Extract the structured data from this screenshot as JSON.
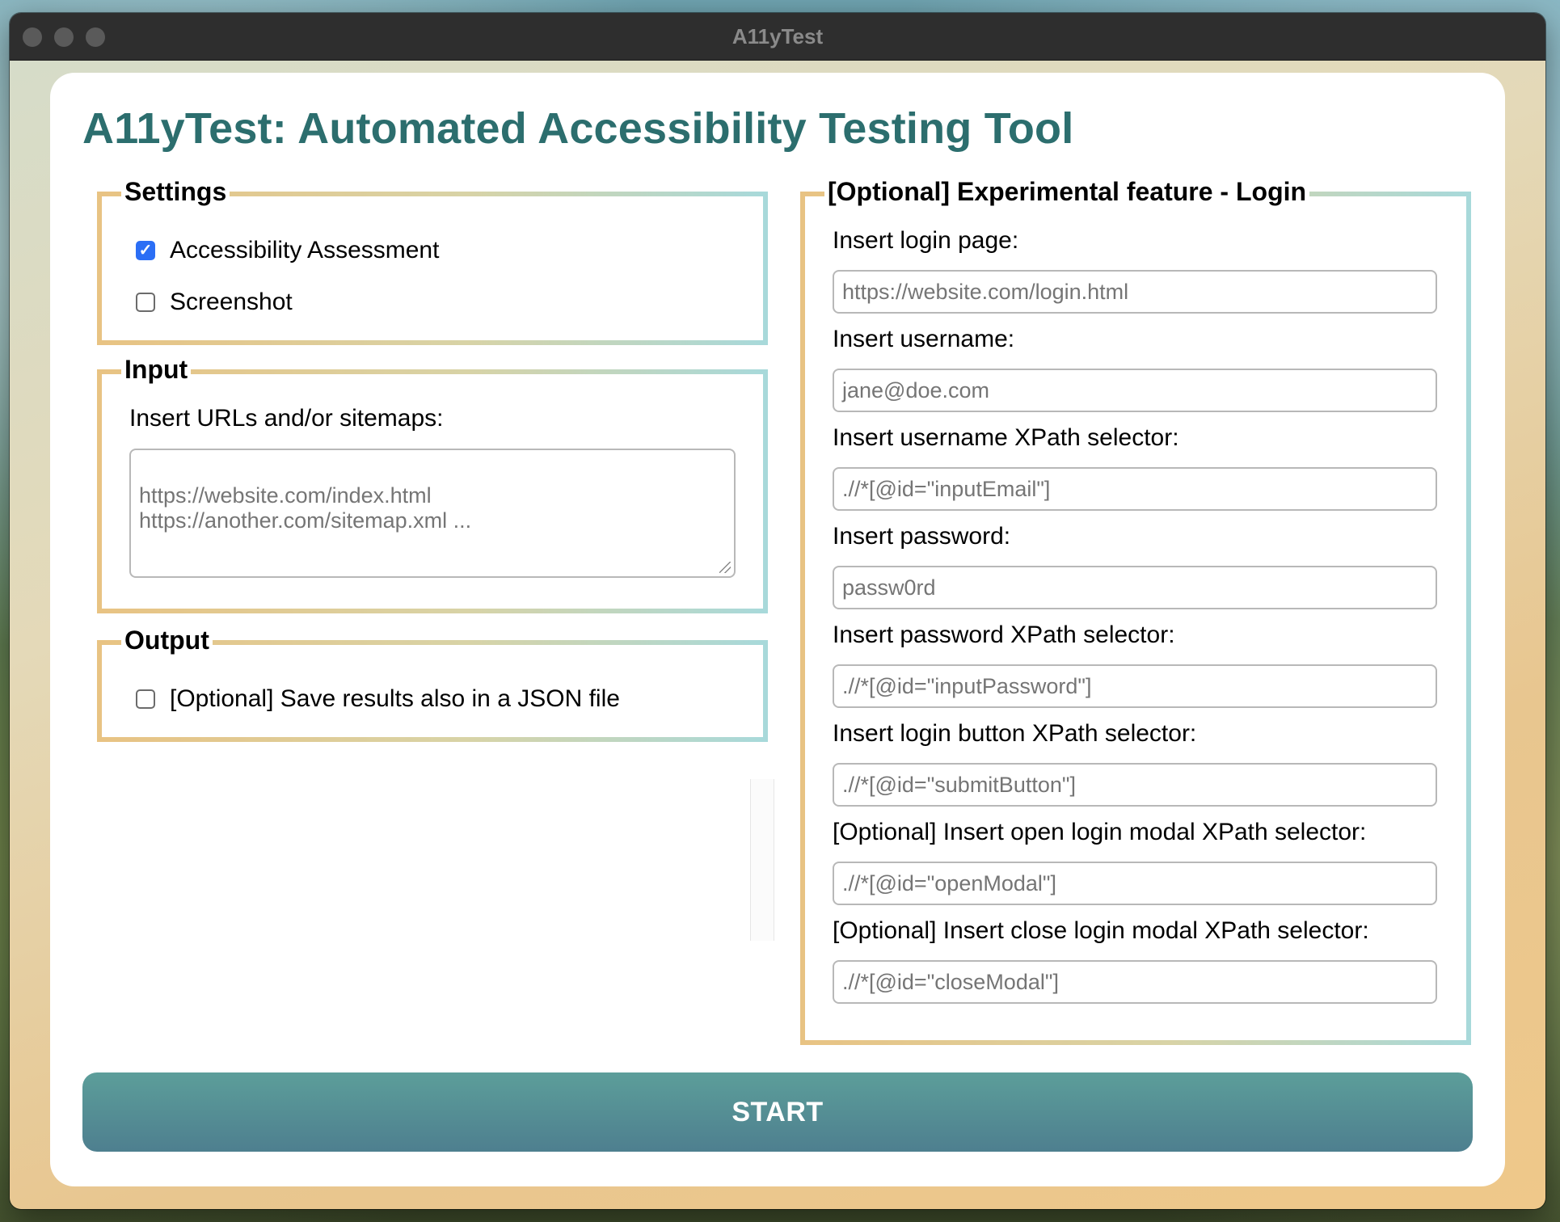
{
  "window": {
    "title": "A11yTest"
  },
  "page": {
    "title": "A11yTest: Automated Accessibility Testing Tool"
  },
  "settings": {
    "legend": "Settings",
    "options": [
      {
        "label": "Accessibility Assessment",
        "checked": true
      },
      {
        "label": "Screenshot",
        "checked": false
      }
    ]
  },
  "input": {
    "legend": "Input",
    "label": "Insert URLs and/or sitemaps:",
    "placeholder": "https://website.com/index.html\nhttps://another.com/sitemap.xml ..."
  },
  "output": {
    "legend": "Output",
    "json_option": {
      "label": "[Optional] Save results also in a JSON file",
      "checked": false
    }
  },
  "login": {
    "legend": "[Optional] Experimental feature - Login",
    "fields": [
      {
        "label": "Insert login page:",
        "placeholder": "https://website.com/login.html"
      },
      {
        "label": "Insert username:",
        "placeholder": "jane@doe.com"
      },
      {
        "label": "Insert username XPath selector:",
        "placeholder": ".//*[@id=\"inputEmail\"]"
      },
      {
        "label": "Insert password:",
        "placeholder": "passw0rd"
      },
      {
        "label": "Insert password XPath selector:",
        "placeholder": ".//*[@id=\"inputPassword\"]"
      },
      {
        "label": "Insert login button XPath selector:",
        "placeholder": ".//*[@id=\"submitButton\"]"
      },
      {
        "label": "[Optional] Insert open login modal XPath selector:",
        "placeholder": ".//*[@id=\"openModal\"]"
      },
      {
        "label": "[Optional] Insert close login modal XPath selector:",
        "placeholder": ".//*[@id=\"closeModal\"]"
      }
    ]
  },
  "actions": {
    "start_label": "START"
  },
  "colors": {
    "title": "#2c6e6e",
    "checkbox_checked": "#2b6ef5",
    "button_top": "#5c9e9a",
    "button_bottom": "#4e7f8f"
  }
}
